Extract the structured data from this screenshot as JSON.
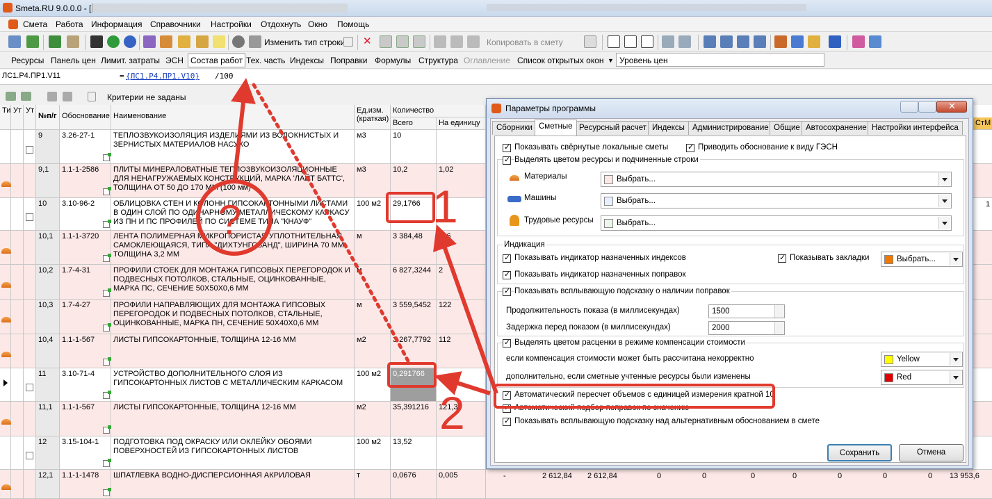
{
  "window": {
    "title": "Smeta.RU  9.0.0.0  - ["
  },
  "menu": [
    "Смета",
    "Работа",
    "Информация",
    "Справочники",
    "Настройки",
    "Отдохнуть",
    "Окно",
    "Помощь"
  ],
  "toolbar1": {
    "change_type": "Изменить тип строки...",
    "copy_to_estimate": "Копировать в смету"
  },
  "toolbar2": [
    "Ресурсы",
    "Панель цен",
    "Лимит. затраты",
    "ЭСН",
    "Состав работ",
    "Тех. часть",
    "Индексы",
    "Поправки",
    "Формулы",
    "Структура",
    "Оглавление",
    "Список открытых окон",
    "Уровень цен"
  ],
  "formula": {
    "cell": "ЛС1.Р4.ПР1.V11",
    "eq": "=",
    "link": "{ЛС1.Р4.ПР1.V10}",
    "tail": "/100"
  },
  "grid_toolbar": {
    "criteria": "Критерии не заданы"
  },
  "grid": {
    "headers": {
      "ti": "Ти",
      "ut": "Ут",
      "num": "№п/г",
      "basis": "Обоснование",
      "name": "Наименование",
      "unit": "Ед.изм. (краткая)",
      "qty": "Количество",
      "qty_total": "Всего",
      "qty_unit": "На единицу",
      "right": "СтМ"
    },
    "rows": [
      {
        "num": "9",
        "basis": "3.26-27-1",
        "name": "ТЕПЛОЗВУКОИЗОЛЯЦИЯ ИЗДЕЛИЯМИ ИЗ ВОЛОКНИСТЫХ И ЗЕРНИСТЫХ МАТЕРИАЛОВ НАСУХО",
        "unit": "м3",
        "total": "10",
        "per": ""
      },
      {
        "num": "9,1",
        "basis": "1.1-1-2586",
        "name": "ПЛИТЫ МИНЕРАЛОВАТНЫЕ ТЕПЛОЗВУКОИЗОЛЯЦИОННЫЕ ДЛЯ НЕНАГРУЖАЕМЫХ КОНСТРУКЦИЙ, МАРКА 'ЛАЙТ БАТТС', ТОЛЩИНА ОТ 50 ДО 170 ММ (100 мм)",
        "unit": "м3",
        "total": "10,2",
        "per": "1,02"
      },
      {
        "num": "10",
        "basis": "3.10-96-2",
        "name": "ОБЛИЦОВКА СТЕН И КОЛОНН ГИПСОКАРТОННЫМИ ЛИСТАМИ В ОДИН СЛОЙ ПО ОДИНАРНОМУ МЕТАЛЛИЧЕСКОМУ КАРКАСУ ИЗ ПН И ПС ПРОФИЛЕЙ ПО СИСТЕМЕ ТИПА \"КНАУФ\"",
        "unit": "100 м2",
        "total": "29,1766",
        "per": ""
      },
      {
        "num": "10,1",
        "basis": "1.1-1-3720",
        "name": "ЛЕНТА ПОЛИМЕРНАЯ МИКРОПОРИСТАЯ УПЛОТНИТЕЛЬНАЯ САМОКЛЕЮЩАЯСЯ, ТИПА \"ДИХТУНГСБАНД\", ШИРИНА 70 ММ, ТОЛЩИНА 3,2 ММ",
        "unit": "м",
        "total": "3 384,48",
        "per": "116"
      },
      {
        "num": "10,2",
        "basis": "1.7-4-31",
        "name": "ПРОФИЛИ СТОЕК ДЛЯ МОНТАЖА ГИПСОВЫХ ПЕРЕГОРОДОК И ПОДВЕСНЫХ ПОТОЛКОВ, СТАЛЬНЫЕ, ОЦИНКОВАННЫЕ, МАРКА ПС, СЕЧЕНИЕ 50Х50Х0,6 ММ",
        "unit": "м",
        "total": "6 827,3244",
        "per": "2"
      },
      {
        "num": "10,3",
        "basis": "1.7-4-27",
        "name": "ПРОФИЛИ НАПРАВЛЯЮЩИХ ДЛЯ МОНТАЖА ГИПСОВЫХ ПЕРЕГОРОДОК И ПОДВЕСНЫХ ПОТОЛКОВ, СТАЛЬНЫЕ, ОЦИНКОВАННЫЕ, МАРКА ПН, СЕЧЕНИЕ 50Х40Х0,6 ММ",
        "unit": "м",
        "total": "3 559,5452",
        "per": "122"
      },
      {
        "num": "10,4",
        "basis": "1.1-1-567",
        "name": "ЛИСТЫ ГИПСОКАРТОННЫЕ, ТОЛЩИНА 12-16 ММ",
        "unit": "м2",
        "total": "3 267,7792",
        "per": "112"
      },
      {
        "num": "11",
        "basis": "3.10-71-4",
        "name": "УСТРОЙСТВО ДОПОЛНИТЕЛЬНОГО СЛОЯ ИЗ ГИПСОКАРТОННЫХ ЛИСТОВ С МЕТАЛЛИЧЕСКИМ КАРКАСОМ",
        "unit": "100 м2",
        "total": "0,291766",
        "per": ""
      },
      {
        "num": "11,1",
        "basis": "1.1-1-567",
        "name": "ЛИСТЫ ГИПСОКАРТОННЫЕ, ТОЛЩИНА 12-16 ММ",
        "unit": "м2",
        "total": "35,391216",
        "per": "121,3"
      },
      {
        "num": "12",
        "basis": "3.15-104-1",
        "name": "ПОДГОТОВКА ПОД ОКРАСКУ ИЛИ ОКЛЕЙКУ ОБОЯМИ ПОВЕРХНОСТЕЙ ИЗ ГИПСОКАРТОННЫХ ЛИСТОВ",
        "unit": "100 м2",
        "total": "13,52",
        "per": ""
      },
      {
        "num": "12,1",
        "basis": "1.1-1-1478",
        "name": "ШПАТЛЕВКА ВОДНО-ДИСПЕРСИОННАЯ АКРИЛОВАЯ",
        "unit": "т",
        "total": "0,0676",
        "per": "0,005"
      }
    ],
    "row_right_values": {
      "dash": "-",
      "v1": "2 612,84",
      "v2": "2 612,84",
      "z": "0",
      "last": "13 953,6",
      "one": "1"
    }
  },
  "dialog": {
    "title": "Параметры программы",
    "tabs": [
      "Сборники",
      "Сметные",
      "Ресурсный расчет",
      "Индексы",
      "Администрирование",
      "Общие",
      "Автосохранение",
      "Настройки интерфейса"
    ],
    "show_collapsed": "Показывать свёрнутые локальные сметы",
    "gesn": "Приводить обоснование к виду ГЭСН",
    "highlight_resources": "Выделять цветом ресурсы и подчиненные строки",
    "materials": "Материалы",
    "machines": "Машины",
    "labor": "Трудовые ресурсы",
    "choose": "Выбрать...",
    "indication": "Индикация",
    "show_indexes": "Показывать индикатор назначенных индексов",
    "show_bookmarks": "Показывать закладки",
    "show_corrections": "Показывать индикатор назначенных поправок",
    "tooltip_corrections": "Показывать всплывающую подсказку о наличии поправок",
    "duration": "Продолжительность показа (в миллисекундах)",
    "duration_val": "1500",
    "delay": "Задержка перед показом (в миллисекундах)",
    "delay_val": "2000",
    "highlight_comp": "Выделять цветом расценки в режиме компенсации стоимости",
    "comp_incorrect": "если компенсация стоимости может быть рассчитана некорректно",
    "comp_changed": "дополнительно, если сметные учтенные ресурсы были изменены",
    "yellow": "Yellow",
    "red": "Red",
    "auto_recalc": "Автоматический пересчет объемов с единицей измерения кратной 10",
    "auto_select": "Автоматический подбор поправок по значению",
    "alt_tooltip": "Показывать всплывающую подсказку над альтернативным обоснованием в смете",
    "save": "Сохранить",
    "cancel": "Отмена",
    "colors": {
      "materials": "#fde8e8",
      "machines": "#e6f0ff",
      "labor": "#eaf7ea",
      "bookmarks": "#f07800",
      "yellow": "#ffff00",
      "red": "#e00000"
    }
  },
  "annotations": {
    "n1": "1",
    "n2": "2",
    "q": "?",
    "color": "#e03a2e"
  }
}
